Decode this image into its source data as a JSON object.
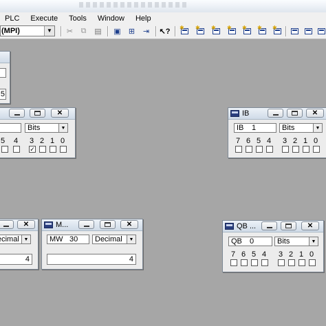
{
  "menu": [
    "PLC",
    "Execute",
    "Tools",
    "Window",
    "Help"
  ],
  "toolbar": {
    "connection": "(MPI)"
  },
  "window_partial_left_top": {
    "value": "5"
  },
  "window_partial_left_mid": {
    "format": "Bits",
    "bit_labels": [
      "5",
      "4",
      "3",
      "2",
      "1",
      "0"
    ],
    "checked": [
      false,
      false,
      true,
      false,
      false,
      false
    ]
  },
  "window_ib": {
    "title": "IB",
    "address_type": "IB",
    "address_num": "1",
    "format": "Bits",
    "bit_labels": [
      "7",
      "6",
      "5",
      "4",
      "3",
      "2",
      "1",
      "0"
    ],
    "checked": [
      false,
      false,
      false,
      false,
      false,
      false,
      false,
      false
    ]
  },
  "window_partial_left_bottom": {
    "format": "ecimal",
    "value": "4"
  },
  "window_mw": {
    "title": "M...",
    "address_type": "MW",
    "address_num": "30",
    "format": "Decimal",
    "value": "4"
  },
  "window_qb": {
    "title": "QB ...",
    "address_type": "QB",
    "address_num": "0",
    "format": "Bits",
    "bit_labels": [
      "7",
      "6",
      "5",
      "4",
      "3",
      "2",
      "1",
      "0"
    ],
    "checked": [
      false,
      false,
      false,
      false,
      false,
      false,
      false,
      false
    ]
  }
}
